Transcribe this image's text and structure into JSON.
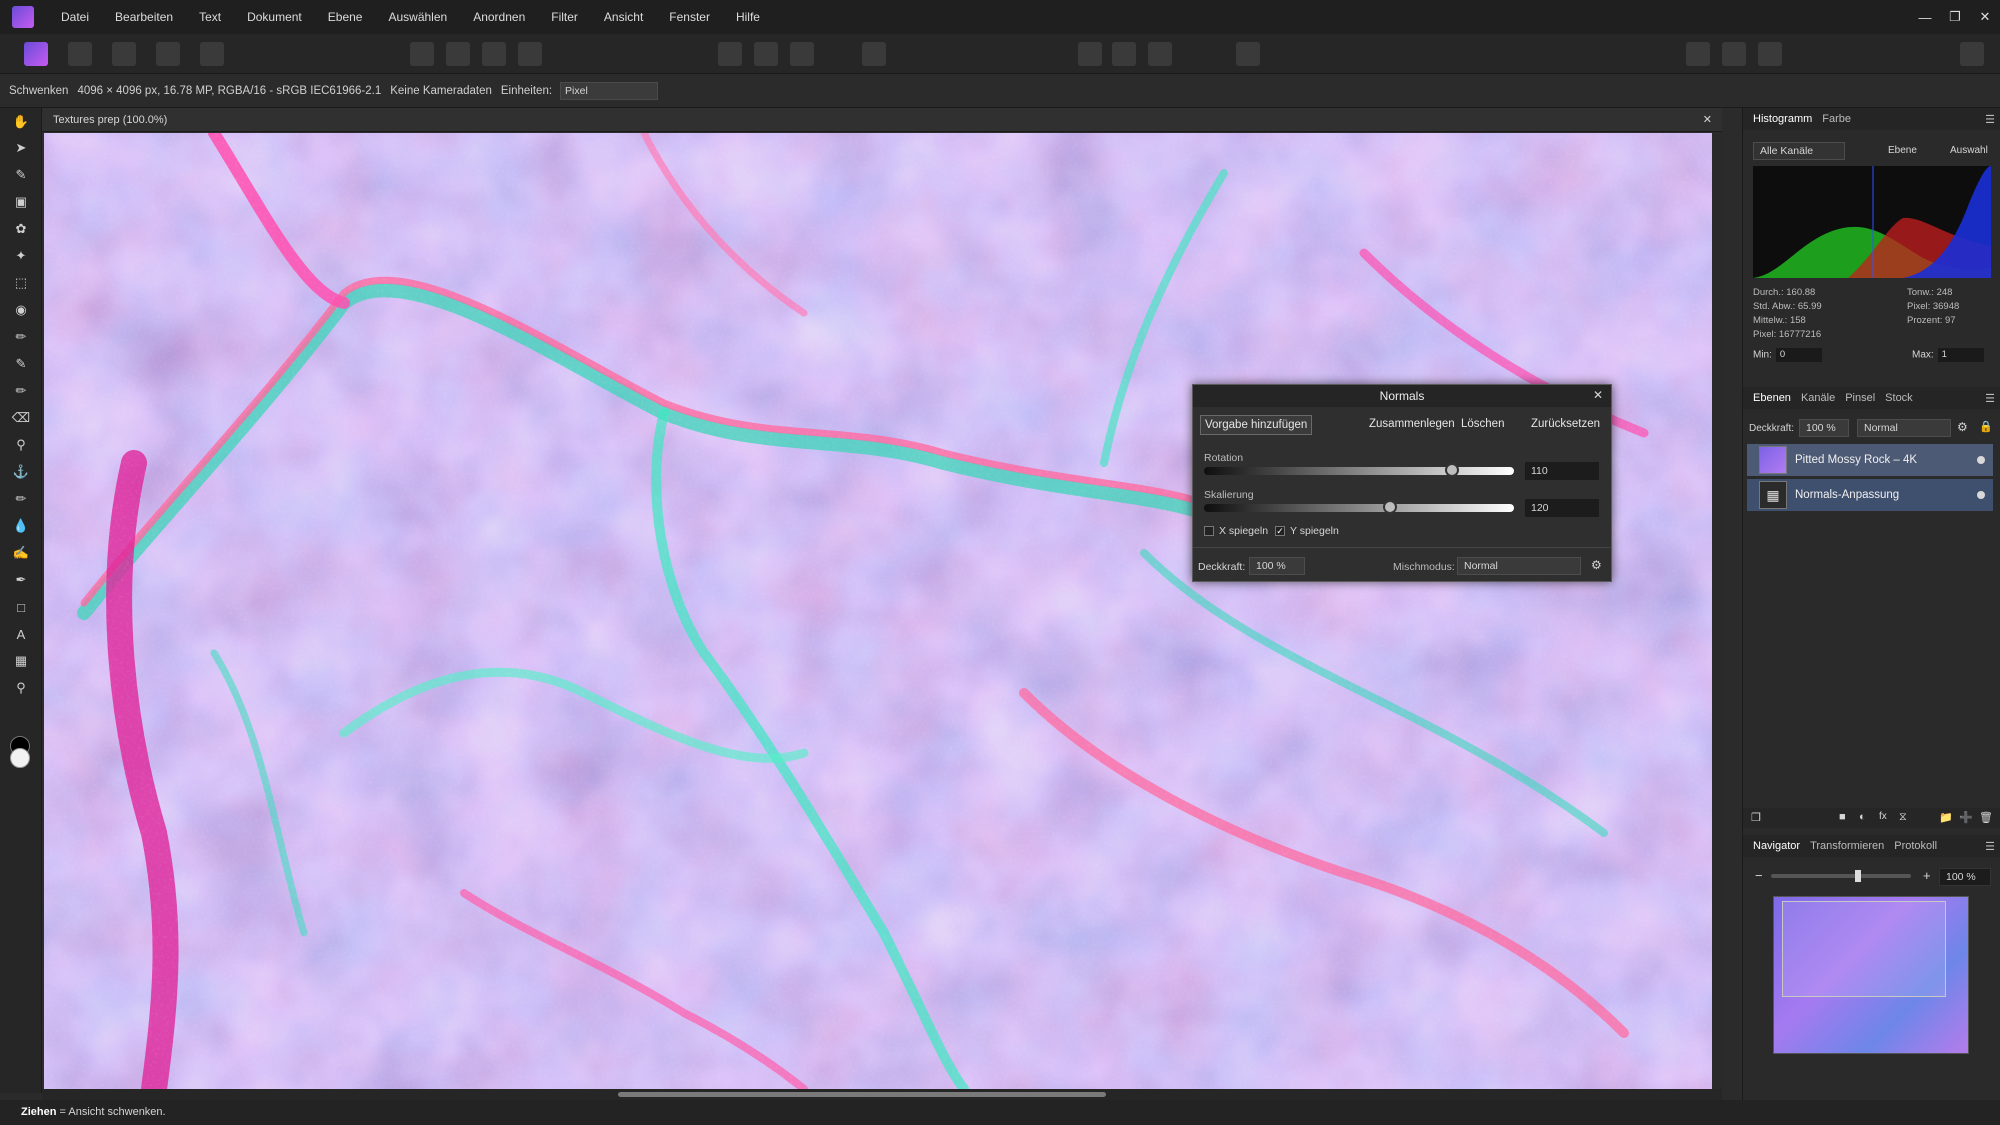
{
  "menu": {
    "items": [
      "Datei",
      "Bearbeiten",
      "Text",
      "Dokument",
      "Ebene",
      "Auswählen",
      "Anordnen",
      "Filter",
      "Ansicht",
      "Fenster",
      "Hilfe"
    ]
  },
  "context": {
    "tool": "Schwenken",
    "doc_info": "4096 × 4096 px, 16.78 MP, RGBA/16 - sRGB IEC61966-2.1",
    "camera": "Keine Kameradaten",
    "units_label": "Einheiten:",
    "units_value": "Pixel"
  },
  "document": {
    "tab_title": "Textures prep (100.0%)"
  },
  "dialog": {
    "title": "Normals",
    "add_preset": "Vorgabe hinzufügen",
    "merge": "Zusammenlegen",
    "delete": "Löschen",
    "reset": "Zurücksetzen",
    "rotation_label": "Rotation",
    "rotation_value": "110",
    "rotation_fraction": 0.8,
    "scale_label": "Skalierung",
    "scale_value": "120",
    "scale_fraction": 0.6,
    "flip_x": "X spiegeln",
    "flip_y": "Y spiegeln",
    "flip_y_checked": "✓",
    "opacity_label": "Deckkraft:",
    "opacity_value": "100 %",
    "blend_label": "Mischmodus:",
    "blend_value": "Normal"
  },
  "histogram": {
    "tabs": [
      "Histogramm",
      "Farbe"
    ],
    "channel": "Alle Kanäle",
    "layer_opt": "Ebene",
    "selection_opt": "Auswahl",
    "stats_left": [
      "Durch.: 160.88",
      "Std. Abw.: 65.99",
      "Mittelw.: 158",
      "Pixel: 16777216"
    ],
    "stats_right": [
      "Tonw.: 248",
      "Pixel: 36948",
      "Prozent: 97"
    ],
    "min_label": "Min:",
    "min_value": "0",
    "max_label": "Max:",
    "max_value": "1"
  },
  "layers": {
    "tabs": [
      "Ebenen",
      "Kanäle",
      "Pinsel",
      "Stock"
    ],
    "opacity_label": "Deckkraft:",
    "opacity_value": "100 %",
    "blend_value": "Normal",
    "items": [
      "Pitted Mossy Rock – 4K",
      "Normals-Anpassung"
    ]
  },
  "navigator": {
    "tabs": [
      "Navigator",
      "Transformieren",
      "Protokoll"
    ],
    "zoom": "100 %",
    "zoom_fraction": 0.62
  },
  "status": {
    "bold": "Ziehen",
    "text": " = Ansicht schwenken."
  }
}
